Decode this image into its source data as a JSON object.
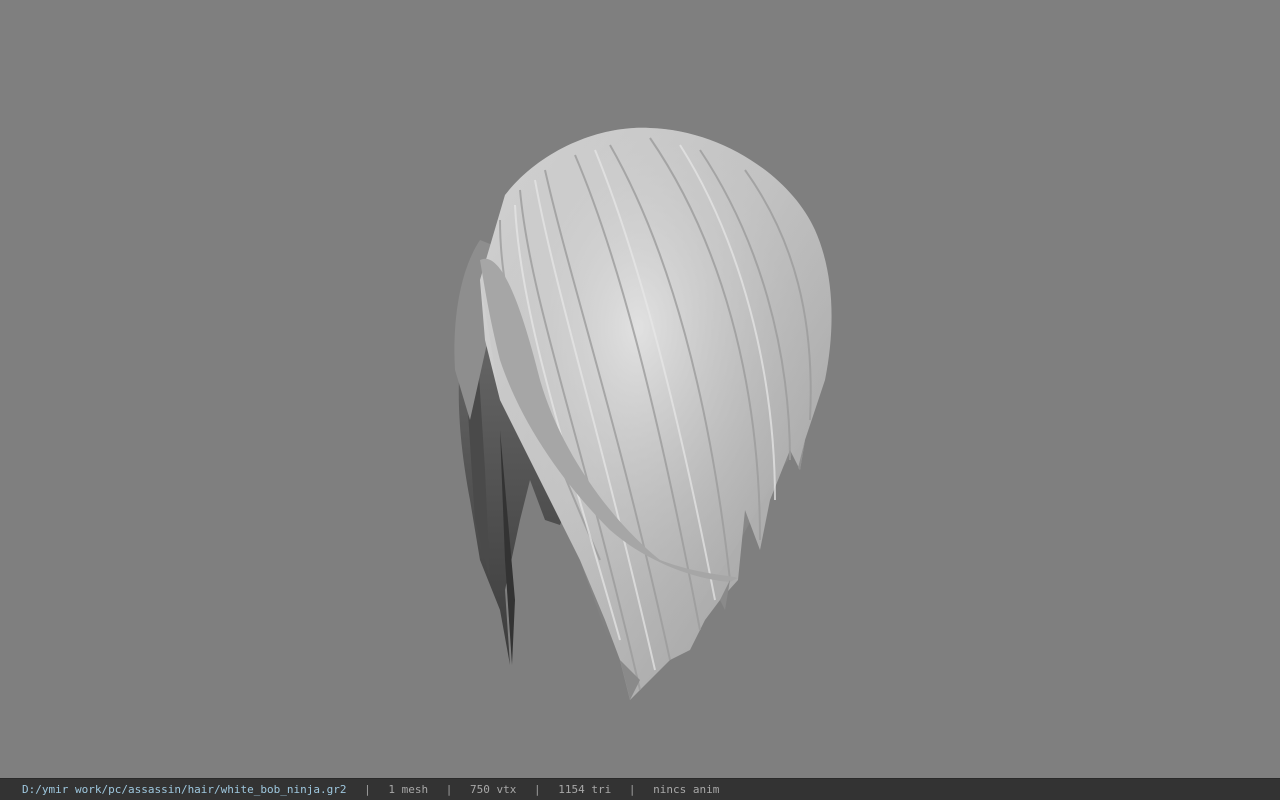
{
  "viewer": {
    "background_color": "#7f7f7f",
    "model_icon": "hair-mesh-model"
  },
  "statusbar": {
    "file_path": "D:/ymir work/pc/assassin/hair/white_bob_ninja.gr2",
    "separator": "|",
    "mesh_count": "1 mesh",
    "vertex_count": "750 vtx",
    "triangle_count": "1154 tri",
    "animation": "nincs anim",
    "path_color": "#9ec7de",
    "text_color": "#a8a8a8"
  }
}
